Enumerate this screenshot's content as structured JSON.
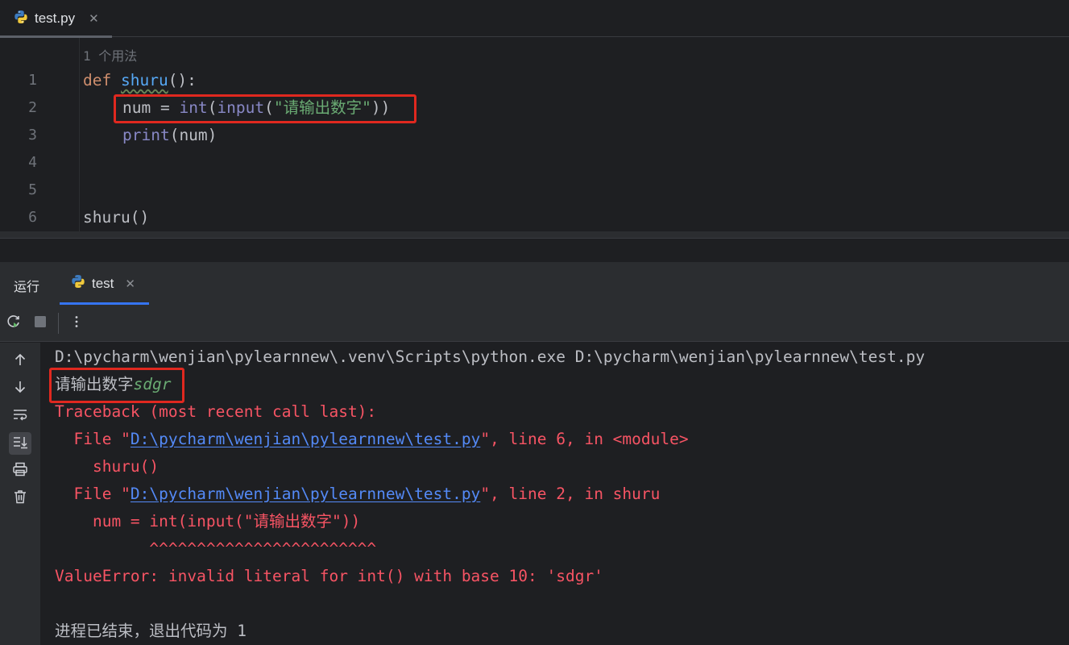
{
  "editor_tab": {
    "label": "test.py",
    "close": "✕"
  },
  "editor": {
    "usage_hint": "1 个用法",
    "line_numbers": [
      "1",
      "2",
      "3",
      "4",
      "5",
      "6"
    ],
    "line1": {
      "kw": "def",
      "name": "shuru",
      "rest": "():"
    },
    "line2": {
      "pre": "num = ",
      "int": "int",
      "p1": "(",
      "input": "input",
      "p2": "(",
      "str": "\"请输出数字\"",
      "close": "))"
    },
    "line3": {
      "print": "print",
      "rest": "(num)"
    },
    "line6": {
      "call": "shuru()"
    }
  },
  "run_panel": {
    "title": "运行",
    "tab_label": "test",
    "tab_close": "✕"
  },
  "console": {
    "cmd": "D:\\pycharm\\wenjian\\pylearnnew\\.venv\\Scripts\\python.exe D:\\pycharm\\wenjian\\pylearnnew\\test.py",
    "prompt": "请输出数字",
    "user_input": "sdgr",
    "traceback_header": "Traceback (most recent call last):",
    "frame1_prefix": "  File \"",
    "frame1_path": "D:\\pycharm\\wenjian\\pylearnnew\\test.py",
    "frame1_suffix": "\", line 6, in <module>",
    "frame1_code": "    shuru()",
    "frame2_prefix": "  File \"",
    "frame2_path": "D:\\pycharm\\wenjian\\pylearnnew\\test.py",
    "frame2_suffix": "\", line 2, in shuru",
    "frame2_code": "    num = int(input(\"请输出数字\"))",
    "carets": "          ^^^^^^^^^^^^^^^^^^^^^^^^",
    "error": "ValueError: invalid literal for int() with base 10: 'sdgr'",
    "exit_msg": "进程已结束，退出代码为 1"
  },
  "colors": {
    "highlight_box": "#e0281f",
    "error_text": "#f75464",
    "link": "#548af7",
    "tab_accent": "#3574f0"
  }
}
